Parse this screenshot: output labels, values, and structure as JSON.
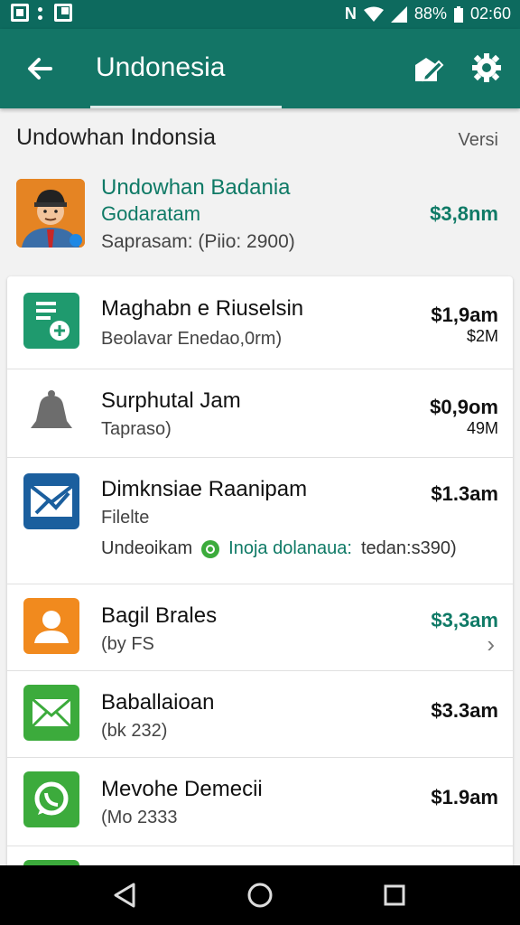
{
  "status_bar": {
    "battery": "88%",
    "time": "02:60",
    "icons": [
      "screenshot-icon",
      "dots-icon",
      "gallery-icon",
      "nfc-icon",
      "wifi-icon",
      "signal-icon",
      "battery-icon"
    ]
  },
  "app_bar": {
    "title": "Undonesia",
    "back_icon": "arrow-left-icon",
    "edit_icon": "edit-icon",
    "settings_icon": "gear-icon"
  },
  "section": {
    "heading": "Undowhan Indonsia",
    "aside": "Versi"
  },
  "featured": {
    "title_line1": "Undowhan Badania",
    "title_line2": "Godaratam",
    "subtitle": "Saprasam: (Piio: 2900)",
    "price": "$3,8nm"
  },
  "items": [
    {
      "name": "Maghabn e Riuselsin",
      "sub": "Beolavar Enedao,0rm)",
      "price": "$1,9am",
      "price_secondary": "$2M",
      "icon": "document-plus-icon",
      "color": "#1f9a6e"
    },
    {
      "name": "Surphutal Jam",
      "sub": "Tapraso)",
      "price": "$0,9om",
      "price_secondary": "49M",
      "icon": "bell-icon",
      "color": "#6d6d6d"
    },
    {
      "name": "Dimknsiae Raanipam",
      "sub": "Filelte",
      "price": "$1.3am",
      "extra_prefix": "Undeoikam",
      "extra_green": "Inoja dolanaua:",
      "extra_suffix": "tedan:s390)",
      "icon": "mail-chart-icon",
      "color": "#1b5f9e"
    },
    {
      "name": "Bagil Brales",
      "sub": "(by FS",
      "price": "$3,3am",
      "icon": "person-icon",
      "color": "#f18a1e",
      "accent": true
    },
    {
      "name": "Baballaioan",
      "sub": "(bk 232)",
      "price": "$3.3am",
      "icon": "mail-icon",
      "color": "#3cab3c"
    },
    {
      "name": "Mevohe Demecii",
      "sub": "(Mo 2333",
      "price": "$1.9am",
      "icon": "whatsapp-icon",
      "color": "#3cab3c"
    }
  ],
  "nav": {
    "back": "back-triangle-icon",
    "home": "home-circle-icon",
    "recents": "recents-square-icon"
  }
}
